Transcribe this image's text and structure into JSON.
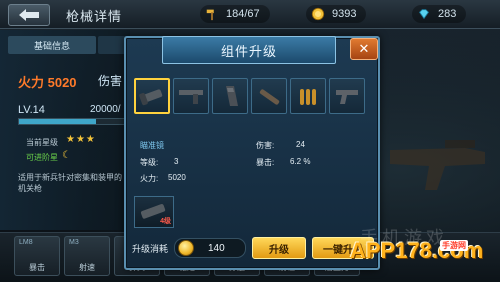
{
  "topbar": {
    "title": "枪械详情",
    "resources": [
      {
        "icon": "hammer-icon",
        "value": "184/67"
      },
      {
        "icon": "gold-coin-icon",
        "value": "9393"
      },
      {
        "icon": "diamond-icon",
        "value": "283"
      }
    ]
  },
  "left_panel": {
    "tab_basic": "基础信息",
    "firepower": "火力 5020",
    "damage_label": "伤害",
    "level": "LV.14",
    "exp": "20000/",
    "exp_progress": 0.7,
    "star_label": "当前星级",
    "stars": "★★★",
    "upgradable_label": "可进阶星",
    "description": "适用于新兵针对密集和装甲的机关枪"
  },
  "dialog": {
    "title": "组件升级",
    "components": [
      {
        "name": "scope-icon",
        "selected": true
      },
      {
        "name": "grip-icon",
        "selected": false
      },
      {
        "name": "magazine-icon",
        "selected": false
      },
      {
        "name": "barrel-icon",
        "selected": false
      },
      {
        "name": "bullets-icon",
        "selected": false
      },
      {
        "name": "pistol-icon",
        "selected": false
      }
    ],
    "selected_name": "瞄准镜",
    "damage_label": "伤害:",
    "damage_value": "24",
    "level_label": "等级:",
    "level_value": "3",
    "crit_label": "暴击:",
    "crit_value": "6.2 %",
    "firepower_label": "火力:",
    "firepower_value": "5020",
    "thumb_badge": "4级",
    "cost_label": "升级消耗",
    "cost_value": "140",
    "upgrade_button": "升级",
    "oneclick_button": "一键升级"
  },
  "bottom_slots": [
    {
      "code": "LM8",
      "label": "暴击"
    },
    {
      "code": "M3",
      "label": "射速"
    },
    {
      "code": "",
      "label": "弹夹"
    },
    {
      "code": "",
      "label": "稳定"
    },
    {
      "code": "",
      "label": "穿透"
    },
    {
      "code": "",
      "label": "射程"
    },
    {
      "code": "",
      "label": "后坐力"
    }
  ],
  "watermark": {
    "brand": "APP178.com",
    "cn": "手机游戏",
    "site": "手游网"
  },
  "colors": {
    "accent": "#ffd23e",
    "firepower": "#ff7a2a",
    "panel_border": "#5a8fb0"
  }
}
